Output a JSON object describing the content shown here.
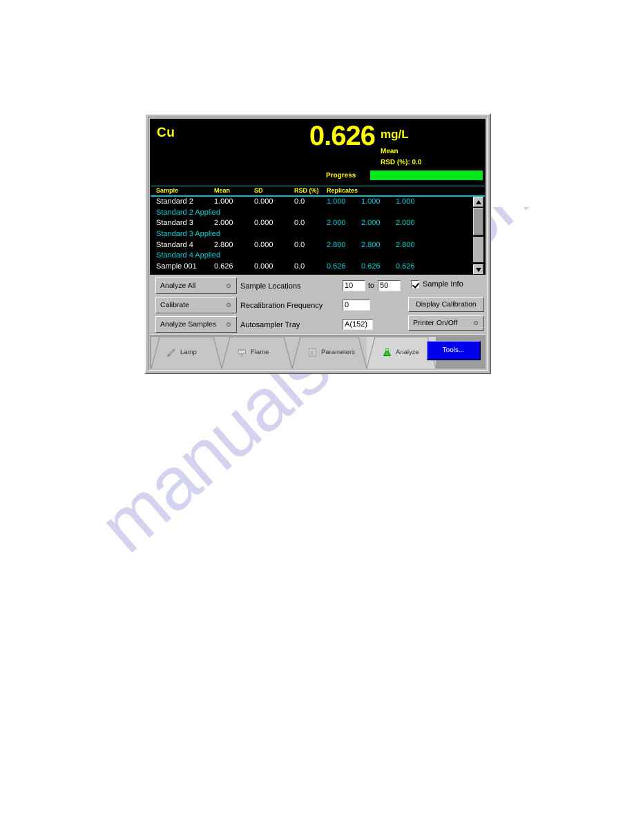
{
  "watermark": {
    "text": "manualshive.com"
  },
  "readout": {
    "element": "Cu",
    "value": "0.626",
    "unit": "mg/L",
    "mean_label": "Mean",
    "rsd_label": "RSD (%): 0.0",
    "progress_label": "Progress",
    "progress_percent": 100,
    "colors": {
      "text": "#ffff00",
      "background": "#000000",
      "progress_fill": "#00e81a",
      "replicate_text": "#00d0d8",
      "separator": "#00c0c8"
    }
  },
  "table": {
    "columns": [
      "Sample",
      "Mean",
      "SD",
      "RSD (%)",
      "Replicates"
    ],
    "rows": [
      {
        "type": "data",
        "sample": "Standard 2",
        "mean": "1.000",
        "sd": "0.000",
        "rsd": "0.0",
        "replicates": [
          "1.000",
          "1.000",
          "1.000"
        ]
      },
      {
        "type": "applied",
        "text": "Standard 2 Applied"
      },
      {
        "type": "data",
        "sample": "Standard 3",
        "mean": "2.000",
        "sd": "0.000",
        "rsd": "0.0",
        "replicates": [
          "2.000",
          "2.000",
          "2.000"
        ]
      },
      {
        "type": "applied",
        "text": "Standard 3 Applied"
      },
      {
        "type": "data",
        "sample": "Standard 4",
        "mean": "2.800",
        "sd": "0.000",
        "rsd": "0.0",
        "replicates": [
          "2.800",
          "2.800",
          "2.800"
        ]
      },
      {
        "type": "applied",
        "text": "Standard 4 Applied"
      },
      {
        "type": "data",
        "sample": "Sample 001",
        "mean": "0.626",
        "sd": "0.000",
        "rsd": "0.0",
        "replicates": [
          "0.626",
          "0.626",
          "0.626"
        ]
      }
    ]
  },
  "controls": {
    "buttons": [
      {
        "label": "Analyze All"
      },
      {
        "label": "Calibrate"
      },
      {
        "label": "Analyze Samples"
      }
    ],
    "fields": [
      {
        "label": "Sample Locations",
        "value_from": "10",
        "to_label": "to",
        "value_to": "50"
      },
      {
        "label": "Recalibration Frequency",
        "value": "0"
      },
      {
        "label": "Autosampler Tray",
        "value": "A(152)"
      }
    ],
    "checkbox": {
      "label": "Sample Info",
      "checked": true
    },
    "display_calibration_label": "Display Calibration",
    "printer_label": "Printer On/Off"
  },
  "tabs": [
    {
      "label": "Lamp",
      "icon": "lamp-icon",
      "active": false
    },
    {
      "label": "Flame",
      "icon": "flame-icon",
      "active": false
    },
    {
      "label": "Parameters",
      "icon": "parameters-icon",
      "active": false
    },
    {
      "label": "Analyze",
      "icon": "flask-icon",
      "active": true
    }
  ],
  "tools_button": {
    "label": "Tools..."
  }
}
